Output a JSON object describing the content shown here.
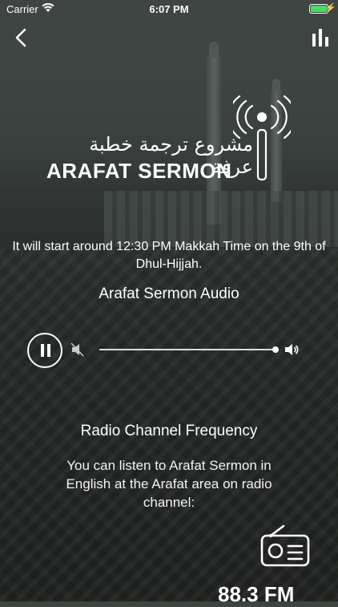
{
  "status_bar": {
    "carrier": "Carrier",
    "time": "6:07 PM",
    "battery_color": "#4cd964"
  },
  "nav": {
    "back_icon": "chevron-left-icon",
    "menu_icon": "bar-chart-icon"
  },
  "logo": {
    "arabic_text": "مشروع ترجمة خطبة عرفة",
    "english_text": "ARAFAT SERMON",
    "icon": "broadcast-tower-icon"
  },
  "notice": "It will start around 12:30 PM Makkah Time on the 9th of Dhul-Hijjah.",
  "audio": {
    "title": "Arafat Sermon Audio",
    "state": "playing",
    "volume_level_percent": 100
  },
  "radio": {
    "title": "Radio Channel Frequency",
    "description": "You can listen to Arafat Sermon in English at the Arafat area on radio channel:",
    "frequency": "88.3 FM",
    "icon": "radio-icon"
  }
}
